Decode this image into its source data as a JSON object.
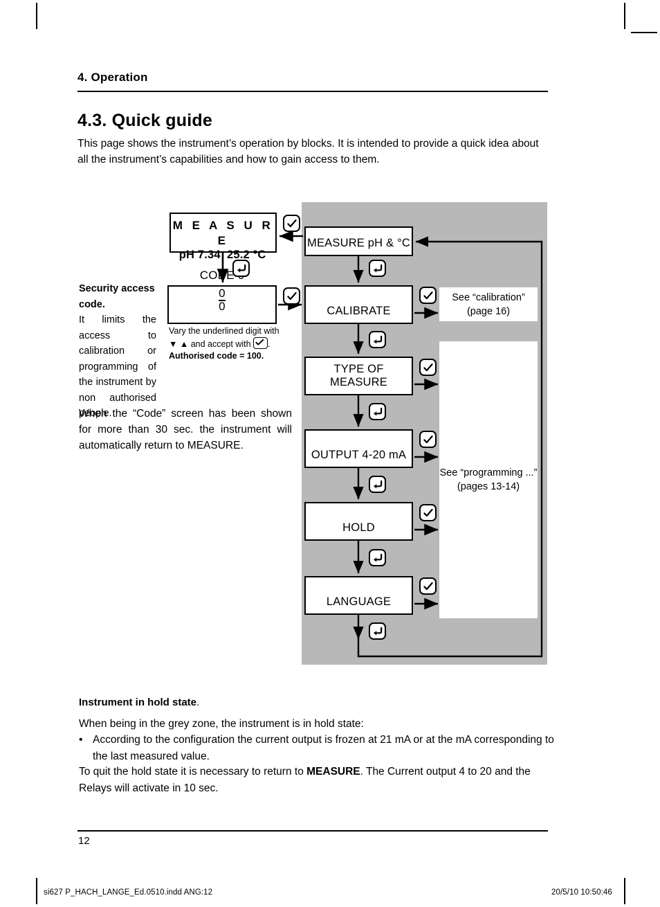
{
  "header": {
    "chapter": "4. Operation",
    "section_title": "4.3. Quick guide",
    "intro": "This page shows the instrument’s operation by blocks. It is intended to provide a quick idea about all the instrument’s capabilities and how to gain access to them."
  },
  "security": {
    "heading": "Security access code.",
    "column_text": "It limits the access to calibration or programming of the instrument by non authorised people.",
    "wide_text": "When the “Code” screen has been shown for more than 30 sec. the instrument will automatically return to MEASURE."
  },
  "diagram": {
    "lcd": {
      "title": "M E A S U R E",
      "ph": "pH 7.34",
      "temp": "25.2 °C"
    },
    "code_box": {
      "label_prefix": "CODE 0",
      "label_underlined": "0",
      "label_suffix": "0",
      "full_label": "CODE 000"
    },
    "code_caption": {
      "line1": "Vary the underlined digit with",
      "line2_prefix": "▼ ▲ and accept with",
      "line2_suffix": ".",
      "line3": "Authorised code = 100."
    },
    "blocks": [
      {
        "id": "measure-ph",
        "label": "MEASURE pH & °C"
      },
      {
        "id": "calibrate",
        "label": "CALIBRATE"
      },
      {
        "id": "type-of-measure",
        "label": "TYPE OF MEASURE"
      },
      {
        "id": "output",
        "label": "OUTPUT 4-20 mA"
      },
      {
        "id": "hold",
        "label": "HOLD"
      },
      {
        "id": "language",
        "label": "LANGUAGE"
      }
    ],
    "references": [
      {
        "id": "calibration",
        "line1": "See “calibration”",
        "line2": "(page 16)"
      },
      {
        "id": "programming",
        "line1": "See “programming ...”",
        "line2": "(pages 13-14)"
      }
    ],
    "keys": {
      "enter": "check-key",
      "back": "back-key"
    },
    "grey_zone_color": "#b8b8b8"
  },
  "hold_state": {
    "heading": "Instrument in hold state",
    "heading_period": ".",
    "p1": "When being in the grey zone, the instrument is in hold state:",
    "bullet_marker": "•",
    "bullet": "According to the configuration the current output is frozen at 21 mA or at the mA corresponding to the last measured value.",
    "p2_part1": "To quit the hold state it is necessary to return to ",
    "p2_bold": "MEASURE",
    "p2_part2": ". The Current output 4 to 20 and the Relays will activate in 10 sec."
  },
  "footer": {
    "page_number": "12",
    "print_meta_left": "si627 P_HACH_LANGE_Ed.0510.indd   ANG:12",
    "print_meta_right": "20/5/10   10:50:46"
  }
}
